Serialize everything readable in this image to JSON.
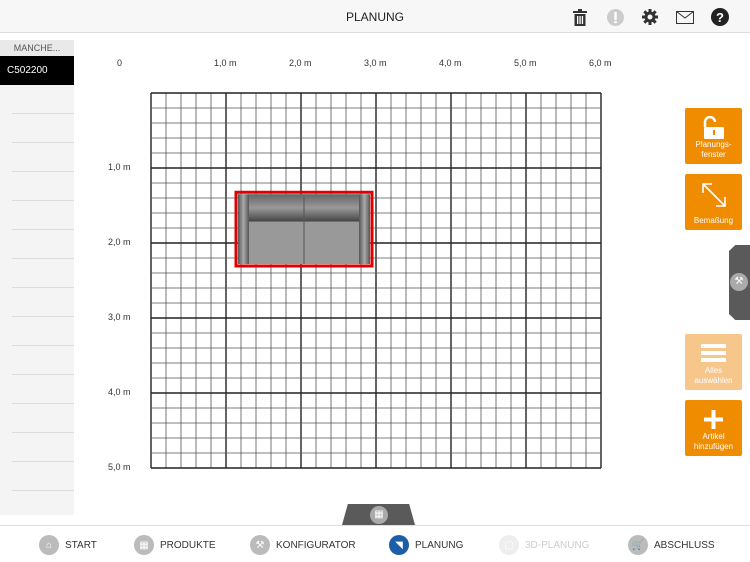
{
  "header": {
    "title": "PLANUNG"
  },
  "sidebar": {
    "header": "MANCHE...",
    "selected": "C502200"
  },
  "ruler": {
    "x": [
      "0",
      "1,0 m",
      "2,0 m",
      "3,0 m",
      "4,0 m",
      "5,0 m",
      "6,0 m"
    ],
    "y": [
      "1,0 m",
      "2,0 m",
      "3,0 m",
      "4,0 m",
      "5,0 m"
    ]
  },
  "plan": {
    "width_m": 6,
    "height_m": 5,
    "subdivisions": 5,
    "item": {
      "x_m": 1.12,
      "y_m": 1.31,
      "w_m": 1.84,
      "h_m": 1.01
    }
  },
  "actions": {
    "planning_window": "Planungs-\nfenster",
    "dimensioning": "Bemaßung",
    "select_all": "Alles\nauswählen",
    "add_item": "Artikel\nhinzufügen"
  },
  "tabs": [
    "START",
    "PRODUKTE",
    "KONFIGURATOR",
    "PLANUNG",
    "3D-PLANUNG",
    "ABSCHLUSS"
  ],
  "colors": {
    "accent": "#f08c00",
    "active_tab": "#1b5fa8",
    "selection": "#e00000"
  }
}
